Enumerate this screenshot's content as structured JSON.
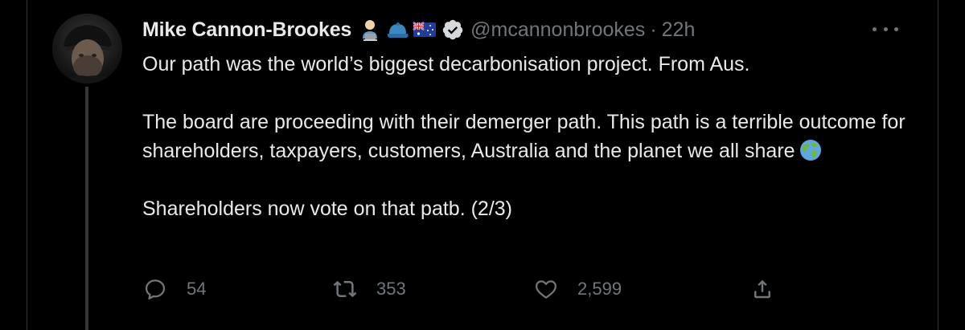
{
  "tweet": {
    "author_name": "Mike Cannon-Brookes",
    "handle": "@mcannonbrookes",
    "separator": "·",
    "time": "22h",
    "paragraphs": [
      "Our path was the world’s biggest decarbonisation project. From Aus.",
      "The board are proceeding with their demerger path.  This path is a terrible outcome for shareholders, taxpayers, customers, Australia and the planet we all share",
      "Shareholders now vote on that patb. (2/3)"
    ],
    "emoji_badges": [
      "technologist-emoji",
      "cap-emoji",
      "australia-flag-emoji"
    ],
    "inline_emoji": "globe-emoji"
  },
  "actions": {
    "reply_count": "54",
    "retweet_count": "353",
    "like_count": "2,599"
  },
  "colors": {
    "background": "#000000",
    "text_primary": "#e7e9ea",
    "text_secondary": "#71767b",
    "border": "#2f3336"
  }
}
